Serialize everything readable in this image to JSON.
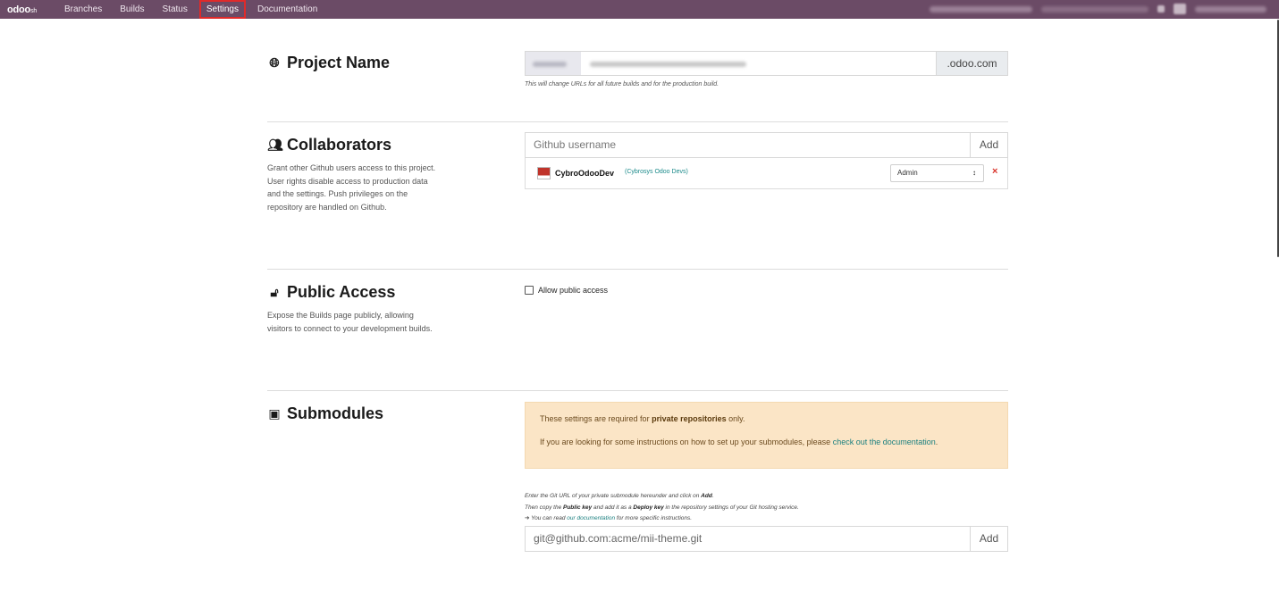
{
  "navbar": {
    "brand": "odoo",
    "brand_suffix": "sh",
    "items": [
      {
        "label": "Branches"
      },
      {
        "label": "Builds"
      },
      {
        "label": "Status"
      },
      {
        "label": "Settings",
        "active": true
      },
      {
        "label": "Documentation"
      }
    ],
    "colors": {
      "background": "#6b4b66",
      "active_outline": "#e02a2a"
    }
  },
  "project_name": {
    "title": "Project Name",
    "icon": "globe-icon",
    "suffix": ".odoo.com",
    "hint": "This will change URLs for all future builds and for the production build."
  },
  "collaborators": {
    "title": "Collaborators",
    "icon": "users-icon",
    "description": "Grant other Github users access to this project. User rights disable access to production data and the settings. Push privileges on the repository are handled on Github.",
    "input_placeholder": "Github username",
    "add_label": "Add",
    "members": [
      {
        "name": "CybroOdooDev",
        "org": "(Cybrosys Odoo Devs)",
        "role": "Admin",
        "remove": "×"
      }
    ]
  },
  "public_access": {
    "title": "Public Access",
    "icon": "lock-icon",
    "description": "Expose the Builds page publicly, allowing visitors to connect to your development builds.",
    "checkbox_label": "Allow public access",
    "checked": false
  },
  "submodules": {
    "title": "Submodules",
    "icon": "cube-icon",
    "alert_line1_pre": "These settings are required for ",
    "alert_line1_bold": "private repositories",
    "alert_line1_post": " only.",
    "alert_line2_pre": "If you are looking for some instructions on how to set up your submodules, please ",
    "alert_line2_link": "check out the documentation",
    "alert_line2_post": ".",
    "instr1_pre": "Enter the Git URL of your private submodule hereunder and click on ",
    "instr1_bold": "Add",
    "instr1_post": ".",
    "instr2_pre": "Then copy the ",
    "instr2_bold1": "Public key",
    "instr2_mid": " and add it as a ",
    "instr2_bold2": "Deploy key",
    "instr2_post": " in the repository settings of your Git hosting service.",
    "instr3_pre": "➔ You can read ",
    "instr3_link": "our documentation",
    "instr3_post": " for more specific instructions.",
    "input_placeholder": "git@github.com:acme/mii-theme.git",
    "add_label": "Add"
  }
}
